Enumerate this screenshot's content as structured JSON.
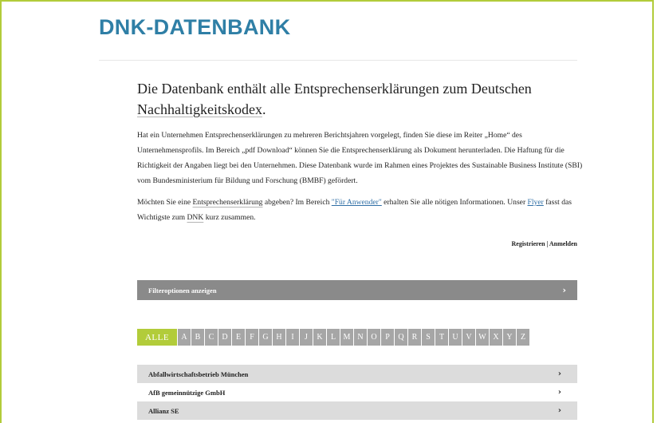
{
  "brand": "DNK-DATENBANK",
  "intro": {
    "title_pre": "Die Datenbank enthält alle Entsprechenserklärungen zum Deutschen ",
    "title_link": "Nachhaltigkeitskodex",
    "title_post": ".",
    "p1": "Hat ein Unternehmen Entsprechenserklärungen zu mehreren Berichtsjahren vorgelegt, finden Sie diese im Reiter „Home“ des Unternehmensprofils. Im Bereich „pdf Download“ können Sie die Entsprechenserklärung als Dokument herunterladen. Die Haftung für die Richtigkeit der Angaben liegt bei den Unternehmen. Diese Datenbank wurde im Rahmen eines Projektes des Sustainable Business Institute (SBI) vom Bundesministerium für Bildung und Forschung (BMBF) gefördert.",
    "p2_a": "Möchten Sie eine ",
    "p2_b": "Entsprechenserklärung",
    "p2_c": " abgeben? Im Bereich ",
    "p2_link1": "\"Für Anwender\"",
    "p2_d": " erhalten Sie alle nötigen Informationen. Unser ",
    "p2_link2": "Flyer",
    "p2_e": " fasst das Wichtigste zum ",
    "p2_f": "DNK",
    "p2_g": " kurz zusammen."
  },
  "auth": {
    "register": "Registrieren",
    "separator": " | ",
    "login": "Anmelden"
  },
  "filter": {
    "label": "Filteroptionen anzeigen",
    "chevron": "›"
  },
  "alphabet": {
    "all": "ALLE",
    "letters": [
      "A",
      "B",
      "C",
      "D",
      "E",
      "F",
      "G",
      "H",
      "I",
      "J",
      "K",
      "L",
      "M",
      "N",
      "O",
      "P",
      "Q",
      "R",
      "S",
      "T",
      "U",
      "V",
      "W",
      "X",
      "Y",
      "Z"
    ]
  },
  "companies": [
    {
      "name": "Abfallwirtschaftsbetrieb München",
      "chevron": "›"
    },
    {
      "name": "AfB gemeinnützige GmbH",
      "chevron": "›"
    },
    {
      "name": "Allianz SE",
      "chevron": "›"
    }
  ],
  "colors": {
    "brand": "#2f7fa6",
    "accent": "#b2cc3a",
    "filter_bar": "#8a8a8a",
    "letter_bg": "#a6a6a6",
    "row_grey": "#dcdcdc"
  }
}
